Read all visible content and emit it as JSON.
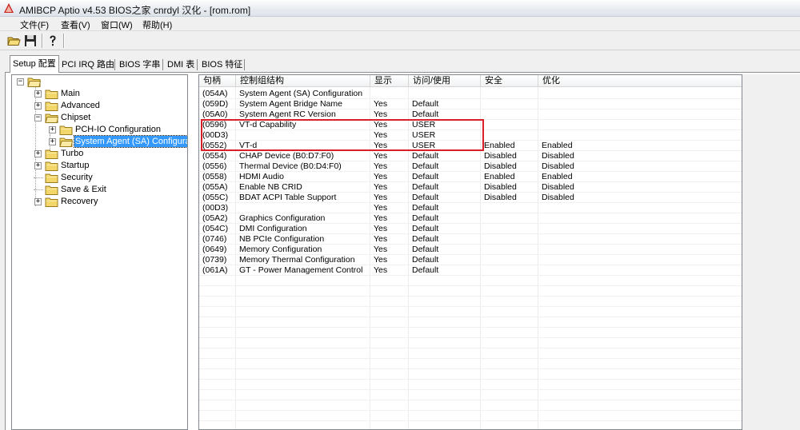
{
  "window": {
    "title": "AMIBCP Aptio v4.53  BIOS之家 cnrdyl 汉化 - [rom.rom]",
    "icon": "amibcp-app-icon"
  },
  "menu": [
    {
      "label": "文件(F)"
    },
    {
      "label": "查看(V)"
    },
    {
      "label": "窗口(W)"
    },
    {
      "label": "帮助(H)"
    }
  ],
  "toolbar": [
    {
      "icon": "open-folder-icon"
    },
    {
      "icon": "save-disk-icon"
    },
    {
      "icon": "help-icon"
    }
  ],
  "tabs": [
    {
      "label": "Setup 配置",
      "active": true
    },
    {
      "label": "PCI IRQ 路由",
      "active": false
    },
    {
      "label": "BIOS 字串",
      "active": false
    },
    {
      "label": "DMI 表",
      "active": false
    },
    {
      "label": "BIOS 特征",
      "active": false
    }
  ],
  "tree": {
    "nodes": [
      {
        "label": "",
        "level": 0,
        "expander": "-"
      },
      {
        "label": "Main",
        "level": 1,
        "expander": "+"
      },
      {
        "label": "Advanced",
        "level": 1,
        "expander": "+"
      },
      {
        "label": "Chipset",
        "level": 1,
        "expander": "-"
      },
      {
        "label": "PCH-IO Configuration",
        "level": 2,
        "expander": "+"
      },
      {
        "label": "System Agent (SA) Configuration",
        "level": 2,
        "expander": "+",
        "selected": true
      },
      {
        "label": "Turbo",
        "level": 1,
        "expander": "+"
      },
      {
        "label": "Startup",
        "level": 1,
        "expander": "+"
      },
      {
        "label": "Security",
        "level": 1,
        "expander": ""
      },
      {
        "label": "Save & Exit",
        "level": 1,
        "expander": ""
      },
      {
        "label": "Recovery",
        "level": 1,
        "expander": "+"
      }
    ]
  },
  "grid": {
    "columns": [
      "句柄",
      "控制组结构",
      "显示",
      "访问/使用",
      "安全",
      "优化"
    ],
    "rows": [
      [
        "(054A)",
        "System Agent (SA) Configuration",
        "",
        "",
        "",
        ""
      ],
      [
        "(059D)",
        "System Agent Bridge Name",
        "Yes",
        "Default",
        "",
        ""
      ],
      [
        "(05A0)",
        "System Agent RC Version",
        "Yes",
        "Default",
        "",
        ""
      ],
      [
        "(0596)",
        "VT-d Capability",
        "Yes",
        "USER",
        "",
        ""
      ],
      [
        "(00D3)",
        "",
        "Yes",
        "USER",
        "",
        ""
      ],
      [
        "(0552)",
        "VT-d",
        "Yes",
        "USER",
        "Enabled",
        "Enabled"
      ],
      [
        "(0554)",
        "CHAP Device (B0:D7:F0)",
        "Yes",
        "Default",
        "Disabled",
        "Disabled"
      ],
      [
        "(0556)",
        "Thermal Device (B0:D4:F0)",
        "Yes",
        "Default",
        "Disabled",
        "Disabled"
      ],
      [
        "(0558)",
        "HDMI Audio",
        "Yes",
        "Default",
        "Enabled",
        "Enabled"
      ],
      [
        "(055A)",
        "Enable NB CRID",
        "Yes",
        "Default",
        "Disabled",
        "Disabled"
      ],
      [
        "(055C)",
        "BDAT ACPI Table Support",
        "Yes",
        "Default",
        "Disabled",
        "Disabled"
      ],
      [
        "(00D3)",
        "",
        "Yes",
        "Default",
        "",
        ""
      ],
      [
        "(05A2)",
        "Graphics Configuration",
        "Yes",
        "Default",
        "",
        ""
      ],
      [
        "(054C)",
        "DMI Configuration",
        "Yes",
        "Default",
        "",
        ""
      ],
      [
        "(0746)",
        "NB PCIe Configuration",
        "Yes",
        "Default",
        "",
        ""
      ],
      [
        "(0649)",
        "Memory Configuration",
        "Yes",
        "Default",
        "",
        ""
      ],
      [
        "(0739)",
        "Memory Thermal Configuration",
        "Yes",
        "Default",
        "",
        ""
      ],
      [
        "(061A)",
        "GT - Power Management Control",
        "Yes",
        "Default",
        "",
        ""
      ]
    ]
  },
  "colors": {
    "highlight_box": "#d8202a",
    "selection": "#3399ff"
  }
}
